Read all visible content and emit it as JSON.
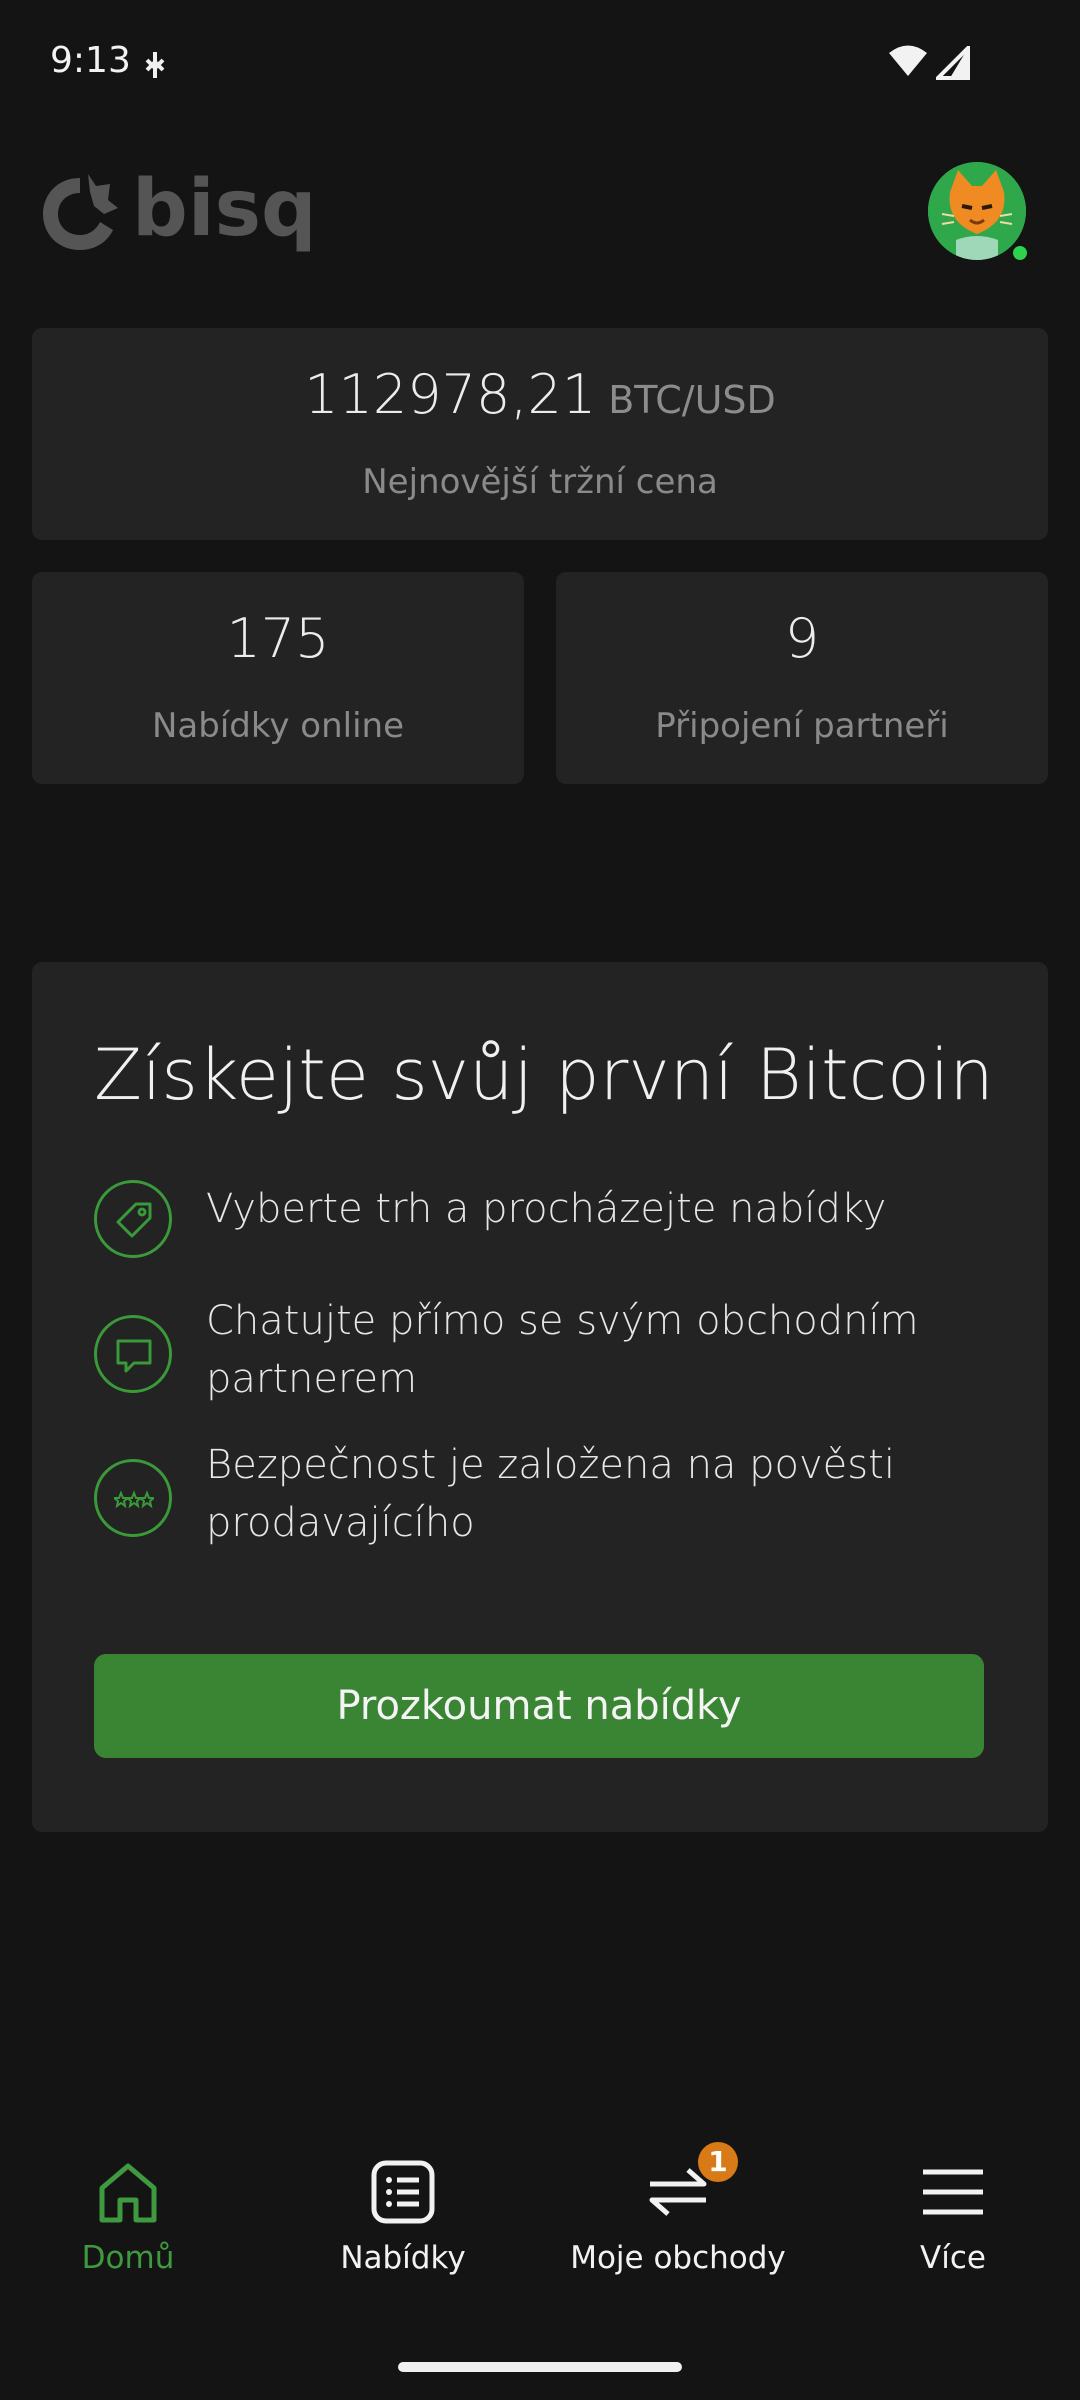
{
  "status_bar": {
    "time": "9:13",
    "icons": [
      "notification-dot-icon",
      "wifi-icon",
      "signal-icon"
    ]
  },
  "header": {
    "logo_text": "bisq",
    "avatar": "cat-avatar-icon",
    "online": true
  },
  "market": {
    "price": "112978,21",
    "pair": "BTC/USD",
    "caption": "Nejnovější tržní cena"
  },
  "stats": {
    "offers_value": "175",
    "offers_label": "Nabídky online",
    "peers_value": "9",
    "peers_label": "Připojení partneři"
  },
  "promo": {
    "title": "Získejte svůj první Bitcoin",
    "features": [
      {
        "icon": "tag-icon",
        "text": "Vyberte trh a procházejte nabídky"
      },
      {
        "icon": "chat-icon",
        "text": "Chatujte přímo se svým obchodním partnerem"
      },
      {
        "icon": "stars-icon",
        "text": "Bezpečnost je založena na pověsti prodavajícího"
      }
    ],
    "button_label": "Prozkoumat nabídky"
  },
  "bottom_nav": {
    "items": [
      {
        "label": "Domů",
        "icon": "home-icon",
        "active": true
      },
      {
        "label": "Nabídky",
        "icon": "list-icon",
        "active": false
      },
      {
        "label": "Moje obchody",
        "icon": "exchange-icon",
        "active": false,
        "badge": "1"
      },
      {
        "label": "Více",
        "icon": "menu-icon",
        "active": false
      }
    ]
  },
  "colors": {
    "background": "#141414",
    "card": "#232323",
    "accent_green": "#3a8533",
    "badge_orange": "#d77a17"
  }
}
